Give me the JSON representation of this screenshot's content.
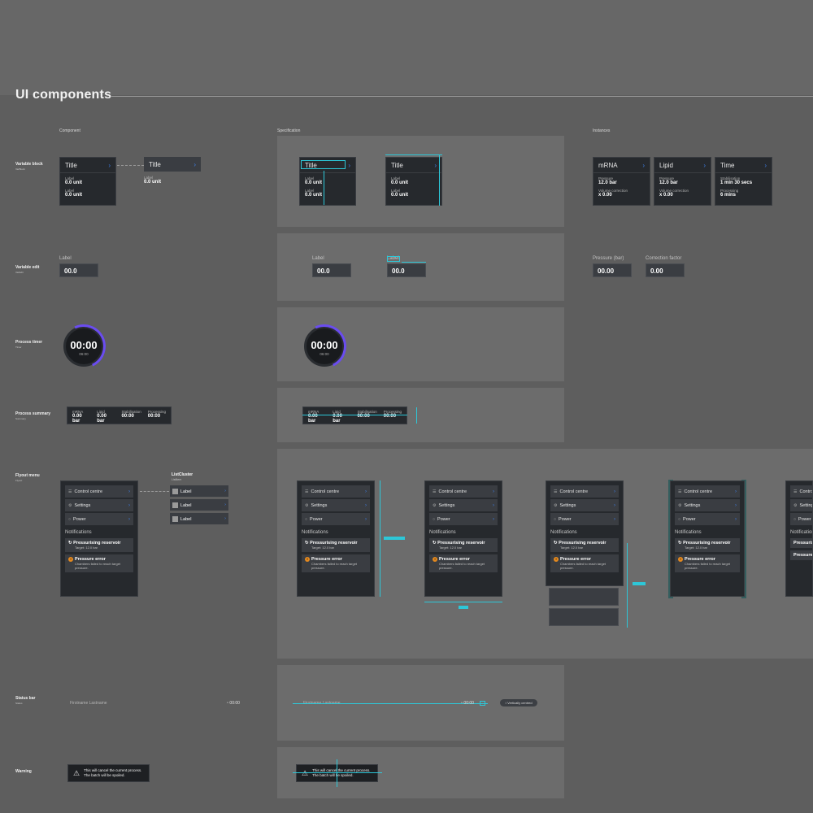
{
  "page_title": "UI components",
  "columns": {
    "component": "Component",
    "specification": "Specification",
    "instances": "Instances"
  },
  "rows": {
    "variable_block": {
      "label": "Variable block",
      "sub": "VarBlock"
    },
    "variable_edit": {
      "label": "Variable edit",
      "sub": "VarEdit"
    },
    "process_timer": {
      "label": "Process timer",
      "sub": "Timer"
    },
    "process_summary": {
      "label": "Process summary",
      "sub": "Summary"
    },
    "flyout_menu": {
      "label": "Flyout menu",
      "sub": "Flyout"
    },
    "status_bar": {
      "label": "Status bar",
      "sub": "Status"
    },
    "warning": {
      "label": "Warning"
    }
  },
  "variable_block": {
    "title": "Title",
    "label": "Label",
    "value": "0.0 unit",
    "instances": [
      {
        "title": "mRNA",
        "l1": "Pressure",
        "v1": "12.0 bar",
        "l2": "Volume correction",
        "v2": "x 0.00"
      },
      {
        "title": "Lipid",
        "l1": "Pressure",
        "v1": "12.0 bar",
        "l2": "Volume correction",
        "v2": "x 0.00"
      },
      {
        "title": "Time",
        "l1": "Stabilisation",
        "v1": "1 min 30 secs",
        "l2": "Processing",
        "v2": "6 mins"
      }
    ]
  },
  "variable_edit": {
    "label": "Label",
    "value": "00.0",
    "instances": [
      {
        "label": "Pressure (bar)",
        "value": "00.00"
      },
      {
        "label": "Correction factor",
        "value": "0.00"
      }
    ]
  },
  "process_timer": {
    "time": "00:00",
    "sub": "06:00"
  },
  "process_summary": {
    "cells": [
      {
        "label": "mRNA",
        "value": "0.00 bar"
      },
      {
        "label": "Lipid",
        "value": "0.00 bar"
      },
      {
        "label": "Stabilisation",
        "value": "00:00"
      },
      {
        "label": "Processing",
        "value": "00:00"
      }
    ]
  },
  "flyout": {
    "items": [
      "Control centre",
      "Settings",
      "Power"
    ],
    "notifications_title": "Notifications",
    "notif1_title": "Pressurising reservoir",
    "notif1_sub": "Target: 12.0 bar",
    "notif2_title": "Pressure error",
    "notif2_sub": "Chambers failed to reach target pressure.",
    "list_cluster_title": "ListCluster",
    "list_cluster_sub": "ListItem",
    "list_item": "Label"
  },
  "status_bar": {
    "name": "Firstname Lastname",
    "time": "00:00",
    "pill": "Vertically centred"
  },
  "warning": {
    "line1": "This will cancel the current process.",
    "line2": "The batch will be spoiled."
  }
}
